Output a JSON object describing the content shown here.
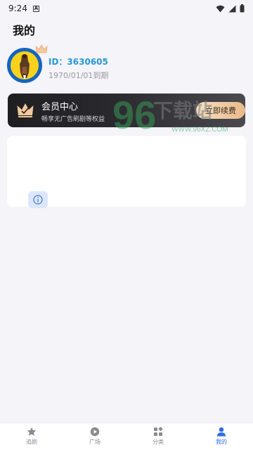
{
  "status_bar": {
    "time": "9:24",
    "notification_letter": "A"
  },
  "page": {
    "title": "我的"
  },
  "profile": {
    "user_id": "ID：3630605",
    "expire_text": "1970/01/01到期"
  },
  "vip": {
    "title": "会员中心",
    "subtitle": "畅享无广告刷剧等权益",
    "button_label": "立即续费"
  },
  "watermark": {
    "big_digits": "96",
    "big_text": "下载站",
    "url": "WWW.96XZ.COM"
  },
  "bottom_nav": {
    "items": [
      {
        "label": "追剧",
        "icon": "star-icon",
        "active": false
      },
      {
        "label": "广场",
        "icon": "play-icon",
        "active": false
      },
      {
        "label": "分类",
        "icon": "category-icon",
        "active": false
      },
      {
        "label": "我的",
        "icon": "person-icon",
        "active": true
      }
    ]
  },
  "colors": {
    "accent": "#2f6ee8",
    "id_blue": "#2996d8",
    "vip_button": "#f0caa0",
    "avatar_yellow": "#f7d21c"
  }
}
